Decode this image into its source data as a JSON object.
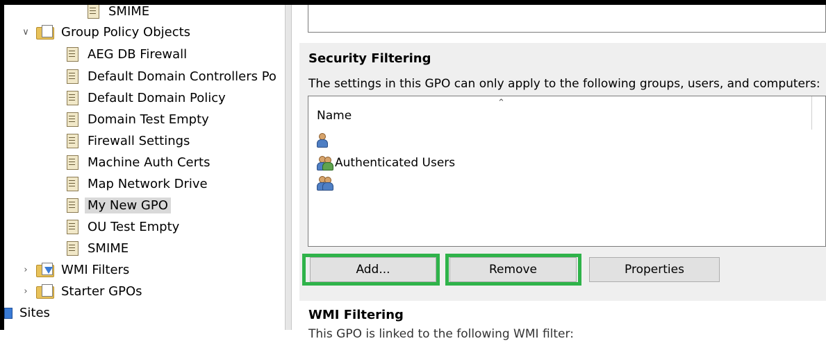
{
  "tree": {
    "items": [
      {
        "label": "SMIME",
        "icon": "gpo-icon",
        "expander": "",
        "selected": false
      },
      {
        "label": "Group Policy Objects",
        "icon": "folder-icon",
        "expander": "expanded",
        "selected": false
      },
      {
        "label": "AEG DB Firewall",
        "icon": "gpo-icon",
        "expander": "",
        "selected": false
      },
      {
        "label": "Default Domain Controllers Po",
        "icon": "gpo-icon",
        "expander": "",
        "selected": false
      },
      {
        "label": "Default Domain Policy",
        "icon": "gpo-icon",
        "expander": "",
        "selected": false
      },
      {
        "label": "Domain Test Empty",
        "icon": "gpo-icon",
        "expander": "",
        "selected": false
      },
      {
        "label": "Firewall Settings",
        "icon": "gpo-icon",
        "expander": "",
        "selected": false
      },
      {
        "label": "Machine Auth Certs",
        "icon": "gpo-icon",
        "expander": "",
        "selected": false
      },
      {
        "label": "Map Network Drive",
        "icon": "gpo-icon",
        "expander": "",
        "selected": false
      },
      {
        "label": "My New GPO",
        "icon": "gpo-icon",
        "expander": "",
        "selected": true
      },
      {
        "label": "OU Test Empty",
        "icon": "gpo-icon",
        "expander": "",
        "selected": false
      },
      {
        "label": "SMIME",
        "icon": "gpo-icon",
        "expander": "",
        "selected": false
      },
      {
        "label": "WMI Filters",
        "icon": "folder-filter-icon",
        "expander": "collapsed",
        "selected": false
      },
      {
        "label": "Starter GPOs",
        "icon": "folder-icon",
        "expander": "collapsed",
        "selected": false
      },
      {
        "label": "Sites",
        "icon": "sites-icon",
        "expander": "",
        "selected": false
      }
    ]
  },
  "security_filtering": {
    "title": "Security Filtering",
    "description": "The settings in this GPO can only apply to the following groups, users, and computers:",
    "column_name": "Name",
    "entries": [
      {
        "label": "",
        "icon": "user-icon"
      },
      {
        "label": "Authenticated Users",
        "icon": "users-group-icon"
      },
      {
        "label": "",
        "icon": "users-icon"
      }
    ],
    "buttons": {
      "add": "Add...",
      "remove": "Remove",
      "properties": "Properties"
    },
    "highlight_color": "#2fb34a"
  },
  "wmi_filtering": {
    "title": "WMI Filtering",
    "description": "This GPO is linked to the following WMI filter:"
  }
}
